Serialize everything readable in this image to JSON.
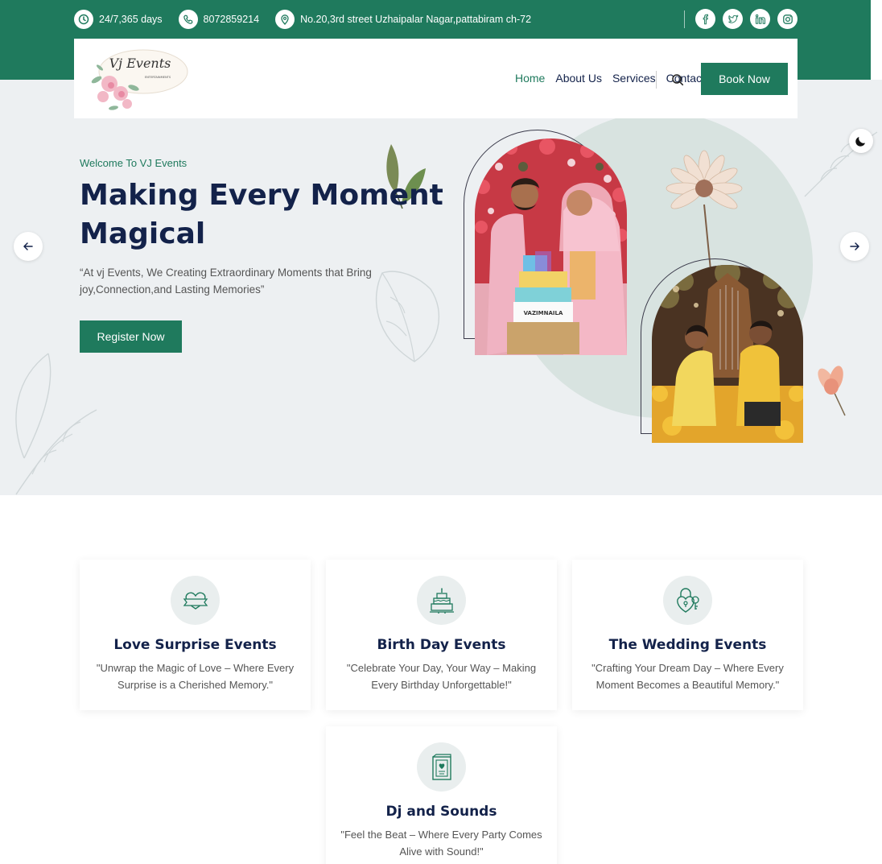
{
  "topbar": {
    "hours": "24/7,365 days",
    "phone": "8072859214",
    "address": "No.20,3rd street Uzhaipalar Nagar,pattabiram ch-72",
    "social": [
      "facebook-icon",
      "twitter-icon",
      "linkedin-icon",
      "instagram-icon"
    ]
  },
  "logo": {
    "text": "Vj Events",
    "subtext": "ENTERTAINMENTS"
  },
  "nav": {
    "items": [
      "Home",
      "About Us",
      "Services",
      "Contact Us"
    ],
    "active": "Home",
    "book_label": "Book Now"
  },
  "hero": {
    "welcome": "Welcome To VJ Events",
    "headline": "Making Every Moment Magical",
    "description": "“At vj Events, We Creating Extraordinary Moments that Bring joy,Connection,and Lasting Memories”",
    "button_label": "Register Now",
    "cake_text": "VAZIMNAILA"
  },
  "services": [
    {
      "icon": "heart-ribbon-icon",
      "title": "Love Surprise Events",
      "text": "\"Unwrap the Magic of Love – Where Every Surprise is a Cherished Memory.\""
    },
    {
      "icon": "cake-icon",
      "title": "Birth Day Events",
      "text": "\"Celebrate Your Day, Your Way – Making Every Birthday Unforgettable!\""
    },
    {
      "icon": "wedding-lock-icon",
      "title": "The Wedding Events",
      "text": "\"Crafting Your Dream Day – Where Every Moment Becomes a Beautiful Memory.\""
    },
    {
      "icon": "invitation-card-icon",
      "title": "Dj and Sounds",
      "text": "\"Feel the Beat – Where Every Party Comes Alive with Sound!\""
    }
  ],
  "colors": {
    "brand": "#1f7a5d",
    "heading": "#13224a",
    "hero_bg": "#edf0f2"
  }
}
